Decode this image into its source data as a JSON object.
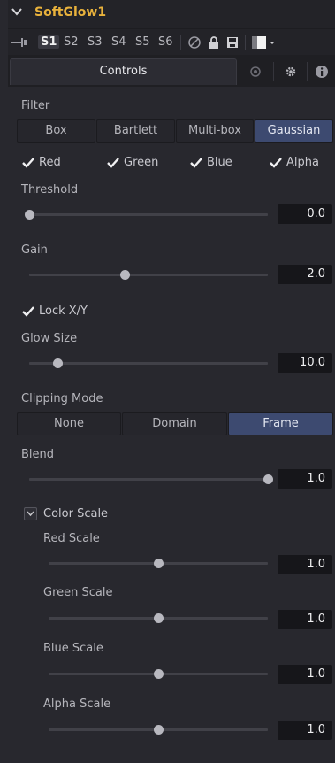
{
  "header": {
    "title": "SoftGlow1",
    "slots": [
      "S1",
      "S2",
      "S3",
      "S4",
      "S5",
      "S6"
    ],
    "active_slot": "S1"
  },
  "tabs": {
    "controls_label": "Controls"
  },
  "filter": {
    "label": "Filter",
    "options": [
      "Box",
      "Bartlett",
      "Multi-box",
      "Gaussian"
    ],
    "selected": "Gaussian"
  },
  "channels": [
    {
      "label": "Red",
      "checked": true
    },
    {
      "label": "Green",
      "checked": true
    },
    {
      "label": "Blue",
      "checked": true
    },
    {
      "label": "Alpha",
      "checked": true
    }
  ],
  "threshold": {
    "label": "Threshold",
    "value": "0.0",
    "fraction": 0.0
  },
  "gain": {
    "label": "Gain",
    "value": "2.0",
    "fraction": 0.4
  },
  "lock_xy": {
    "label": "Lock X/Y",
    "checked": true
  },
  "glow_size": {
    "label": "Glow Size",
    "value": "10.0",
    "fraction": 0.12
  },
  "clipping_mode": {
    "label": "Clipping Mode",
    "options": [
      "None",
      "Domain",
      "Frame"
    ],
    "selected": "Frame"
  },
  "blend": {
    "label": "Blend",
    "value": "1.0",
    "fraction": 1.0
  },
  "color_scale": {
    "label": "Color Scale",
    "expanded": true,
    "red": {
      "label": "Red Scale",
      "value": "1.0",
      "fraction": 0.5
    },
    "green": {
      "label": "Green Scale",
      "value": "1.0",
      "fraction": 0.5
    },
    "blue": {
      "label": "Blue Scale",
      "value": "1.0",
      "fraction": 0.5
    },
    "alpha": {
      "label": "Alpha Scale",
      "value": "1.0",
      "fraction": 0.5
    }
  },
  "colors": {
    "title": "#e9b23c",
    "selected_segment": "#3d4a70",
    "panel_bg": "#28282e"
  }
}
